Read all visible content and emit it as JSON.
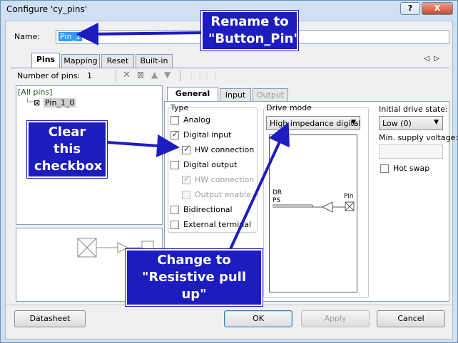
{
  "window": {
    "title": "Configure 'cy_pins'",
    "help_btn": "?",
    "close_btn": "X"
  },
  "name_field": {
    "label": "Name:",
    "value": "Pin_1"
  },
  "main_tabs": [
    "Pins",
    "Mapping",
    "Reset",
    "Built-in"
  ],
  "tab_nav": {
    "prev": "◁",
    "next": "▷"
  },
  "pins_toolbar": {
    "count_label": "Number of pins:",
    "count_value": "1"
  },
  "pin_tree": {
    "root": "[All pins]",
    "child": "Pin_1_0"
  },
  "sub_tabs": [
    "General",
    "Input",
    "Output"
  ],
  "type_group": {
    "title": "Type",
    "analog": "Analog",
    "digital_input": "Digital input",
    "hw_connection": "HW connection",
    "digital_output": "Digital output",
    "hw_connection_out": "HW connection",
    "output_enable": "Output enable",
    "bidirectional": "Bidirectional",
    "external_terminal": "External terminal"
  },
  "drive_mode": {
    "title": "Drive mode",
    "selected": "High impedance digital",
    "diagram_dr": "DR",
    "diagram_ps": "PS",
    "diagram_pin": "Pin"
  },
  "initial_drive": {
    "label": "Initial drive state:",
    "selected": "Low (0)"
  },
  "min_supply": {
    "label": "Min. supply voltage:",
    "value": ""
  },
  "hot_swap": {
    "label": "Hot swap"
  },
  "buttons": {
    "datasheet": "Datasheet",
    "ok": "OK",
    "apply": "Apply",
    "cancel": "Cancel"
  },
  "annotations": {
    "rename": "Rename to\n\"Button_Pin\"",
    "clear": "Clear this\ncheckbox",
    "change": "Change to\n\"Resistive pull up\""
  },
  "colors": {
    "callout_bg": "#1d1dbf",
    "callout_text": "#ffffff",
    "arrow": "#1d1dbf"
  }
}
